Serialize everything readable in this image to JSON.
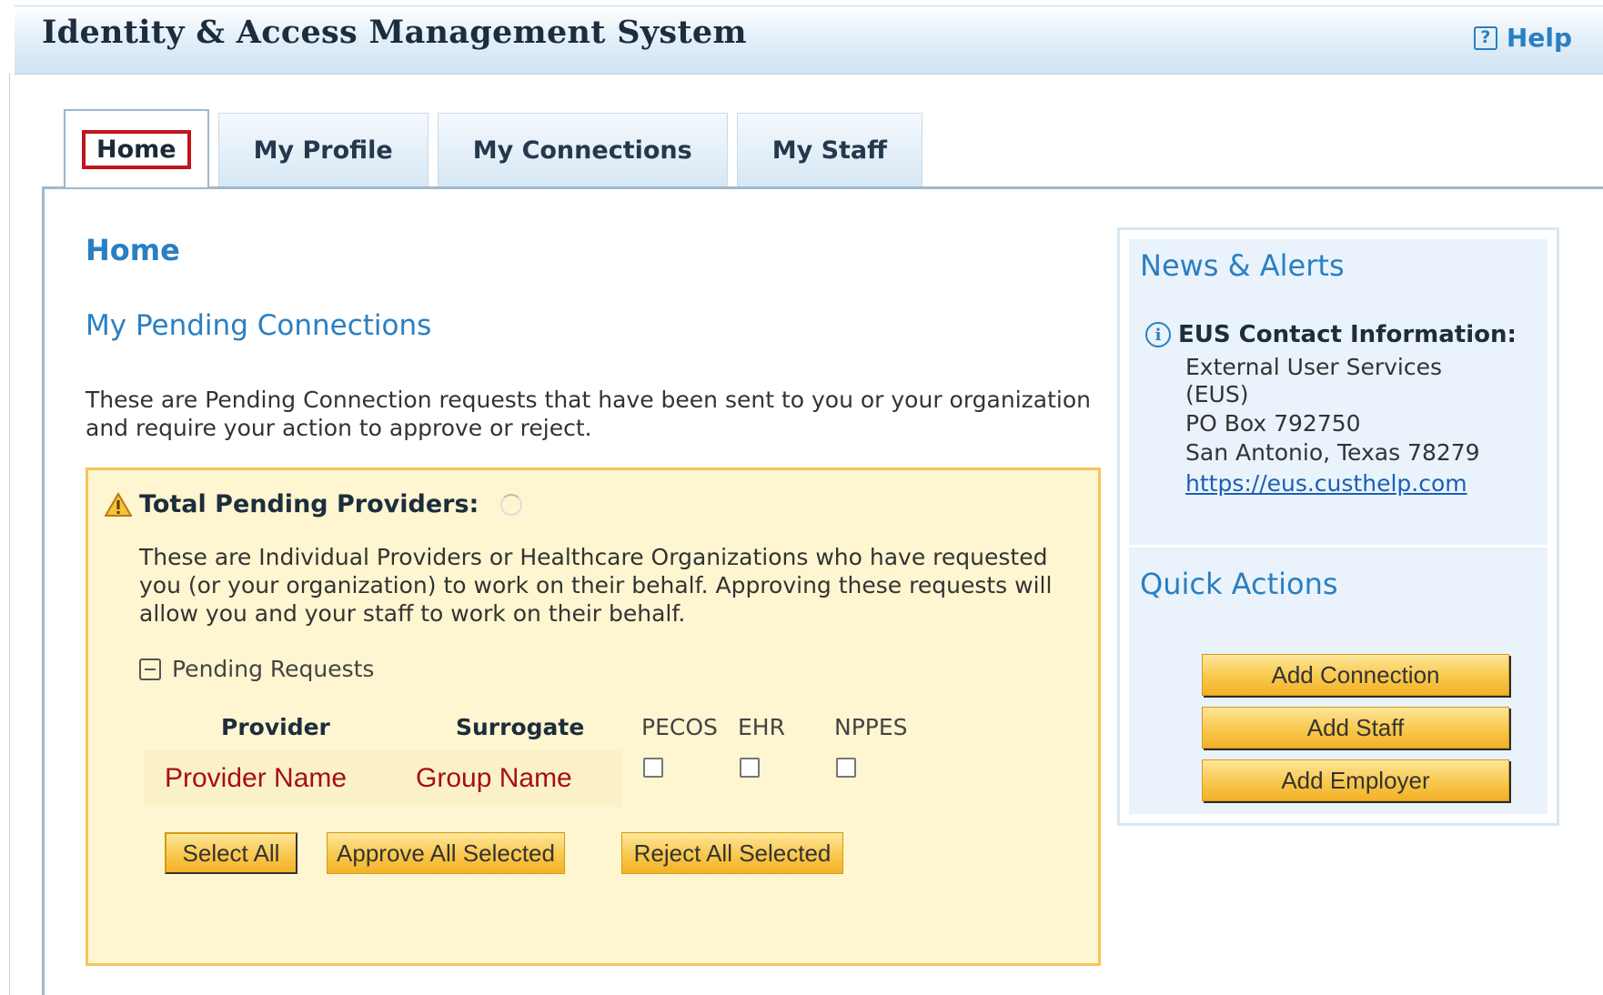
{
  "header": {
    "title": "Identity & Access Management System",
    "help_label": "Help",
    "help_icon": "help-icon"
  },
  "tabs": [
    {
      "label": "Home",
      "active": true
    },
    {
      "label": "My Profile"
    },
    {
      "label": "My Connections"
    },
    {
      "label": "My Staff"
    }
  ],
  "main": {
    "page_title": "Home",
    "section_title": "My Pending Connections",
    "intro": "These are Pending Connection requests that have been sent to you or your organization and require your action to approve or reject.",
    "pending": {
      "heading": "Total Pending Providers:",
      "heading_icon": "warning-icon",
      "description": "These are Individual Providers or Healthcare Organizations who have requested you (or your organization) to work on their behalf. Approving these requests will allow you and your staff to work on their behalf.",
      "toggle_label": "Pending Requests",
      "columns": [
        "Provider",
        "Surrogate",
        "PECOS",
        "EHR",
        "NPPES"
      ],
      "rows": [
        {
          "provider": "Provider Name",
          "surrogate": "Group Name",
          "pecos": false,
          "ehr": false,
          "nppes": false
        }
      ],
      "buttons": {
        "select_all": "Select All",
        "approve": "Approve All Selected",
        "reject": "Reject All Selected"
      }
    }
  },
  "sidebar": {
    "news_title": "News & Alerts",
    "eus": {
      "heading": "EUS Contact Information:",
      "lines": [
        "External User Services",
        "(EUS)",
        "PO Box 792750",
        "San Antonio, Texas 78279"
      ],
      "link": "https://eus.custhelp.com"
    },
    "quick_title": "Quick Actions",
    "quick_actions": [
      "Add Connection",
      "Add Staff",
      "Add Employer"
    ]
  },
  "colors": {
    "accent": "#2a7fc2",
    "button": "#f9c84c",
    "highlight": "#c0141c",
    "row_text": "#a50f17",
    "pending_bg": "#fdf6d0"
  }
}
